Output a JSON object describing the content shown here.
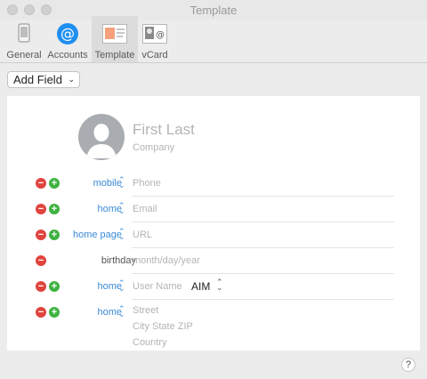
{
  "window": {
    "title": "Template"
  },
  "toolbar": {
    "items": [
      {
        "label": "General",
        "icon": "phone-icon"
      },
      {
        "label": "Accounts",
        "icon": "at-sign-icon"
      },
      {
        "label": "Template",
        "icon": "template-card-icon",
        "selected": true
      },
      {
        "label": "vCard",
        "icon": "vcard-icon"
      }
    ]
  },
  "add_field": {
    "label": "Add Field"
  },
  "card": {
    "name_placeholder": "First Last",
    "company_placeholder": "Company",
    "fields": [
      {
        "label": "mobile",
        "value": "Phone",
        "removable": true,
        "addable": true
      },
      {
        "label": "home",
        "value": "Email",
        "removable": true,
        "addable": true
      },
      {
        "label": "home page",
        "value": "URL",
        "removable": true,
        "addable": true
      },
      {
        "label": "birthday",
        "value": "month/day/year",
        "removable": true,
        "addable": false
      },
      {
        "label": "home",
        "value": "User Name",
        "service": "AIM",
        "removable": true,
        "addable": true
      },
      {
        "label": "home",
        "lines": [
          "Street",
          "City  State  ZIP",
          "Country"
        ],
        "removable": true,
        "addable": true
      }
    ]
  },
  "help": {
    "label": "?"
  },
  "colors": {
    "accent": "#3b8bd6",
    "remove": "#e0443e",
    "add": "#3fb242"
  }
}
